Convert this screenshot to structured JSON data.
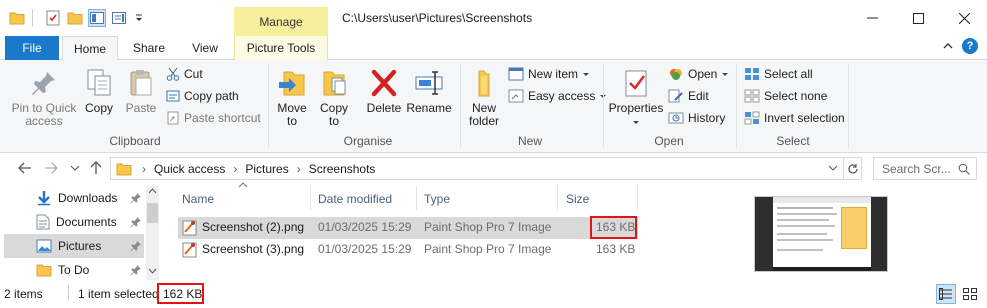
{
  "window": {
    "title": "C:\\Users\\user\\Pictures\\Screenshots",
    "context_tab_header": "Manage"
  },
  "tabs": [
    "File",
    "Home",
    "Share",
    "View",
    "Picture Tools"
  ],
  "ribbon": {
    "clipboard": {
      "label": "Clipboard",
      "pin_line1": "Pin to Quick",
      "pin_line2": "access",
      "copy": "Copy",
      "paste": "Paste",
      "cut": "Cut",
      "copy_path": "Copy path",
      "paste_shortcut": "Paste shortcut"
    },
    "organise": {
      "label": "Organise",
      "move_line1": "Move",
      "move_line2": "to",
      "copy_line1": "Copy",
      "copy_line2": "to",
      "delete": "Delete",
      "rename": "Rename"
    },
    "new": {
      "label": "New",
      "folder_line1": "New",
      "folder_line2": "folder",
      "new_item": "New item",
      "easy_access": "Easy access"
    },
    "open": {
      "label": "Open",
      "properties": "Properties",
      "open": "Open",
      "edit": "Edit",
      "history": "History"
    },
    "select": {
      "label": "Select",
      "select_all": "Select all",
      "select_none": "Select none",
      "invert": "Invert selection"
    }
  },
  "address": {
    "crumbs": [
      "Quick access",
      "Pictures",
      "Screenshots"
    ],
    "search_placeholder": "Search Scr..."
  },
  "nav": {
    "items": [
      {
        "label": "Downloads"
      },
      {
        "label": "Documents"
      },
      {
        "label": "Pictures"
      },
      {
        "label": "To Do"
      }
    ]
  },
  "files": {
    "columns": [
      "Name",
      "Date modified",
      "Type",
      "Size"
    ],
    "rows": [
      {
        "name": "Screenshot (2).png",
        "date": "01/03/2025 15:29",
        "type": "Paint Shop Pro 7 Image",
        "size": "163 KB"
      },
      {
        "name": "Screenshot (3).png",
        "date": "01/03/2025 15:29",
        "type": "Paint Shop Pro 7 Image",
        "size": "163 KB"
      }
    ]
  },
  "status": {
    "items_count": "2 items",
    "selected": "1 item selected",
    "selected_size": "162 KB"
  },
  "colors": {
    "file_tab": "#1979ca",
    "manage_header": "#f7ef9e",
    "selection": "#d9d9d9",
    "highlight_box": "#e01616",
    "folder": "#f7c64b"
  }
}
